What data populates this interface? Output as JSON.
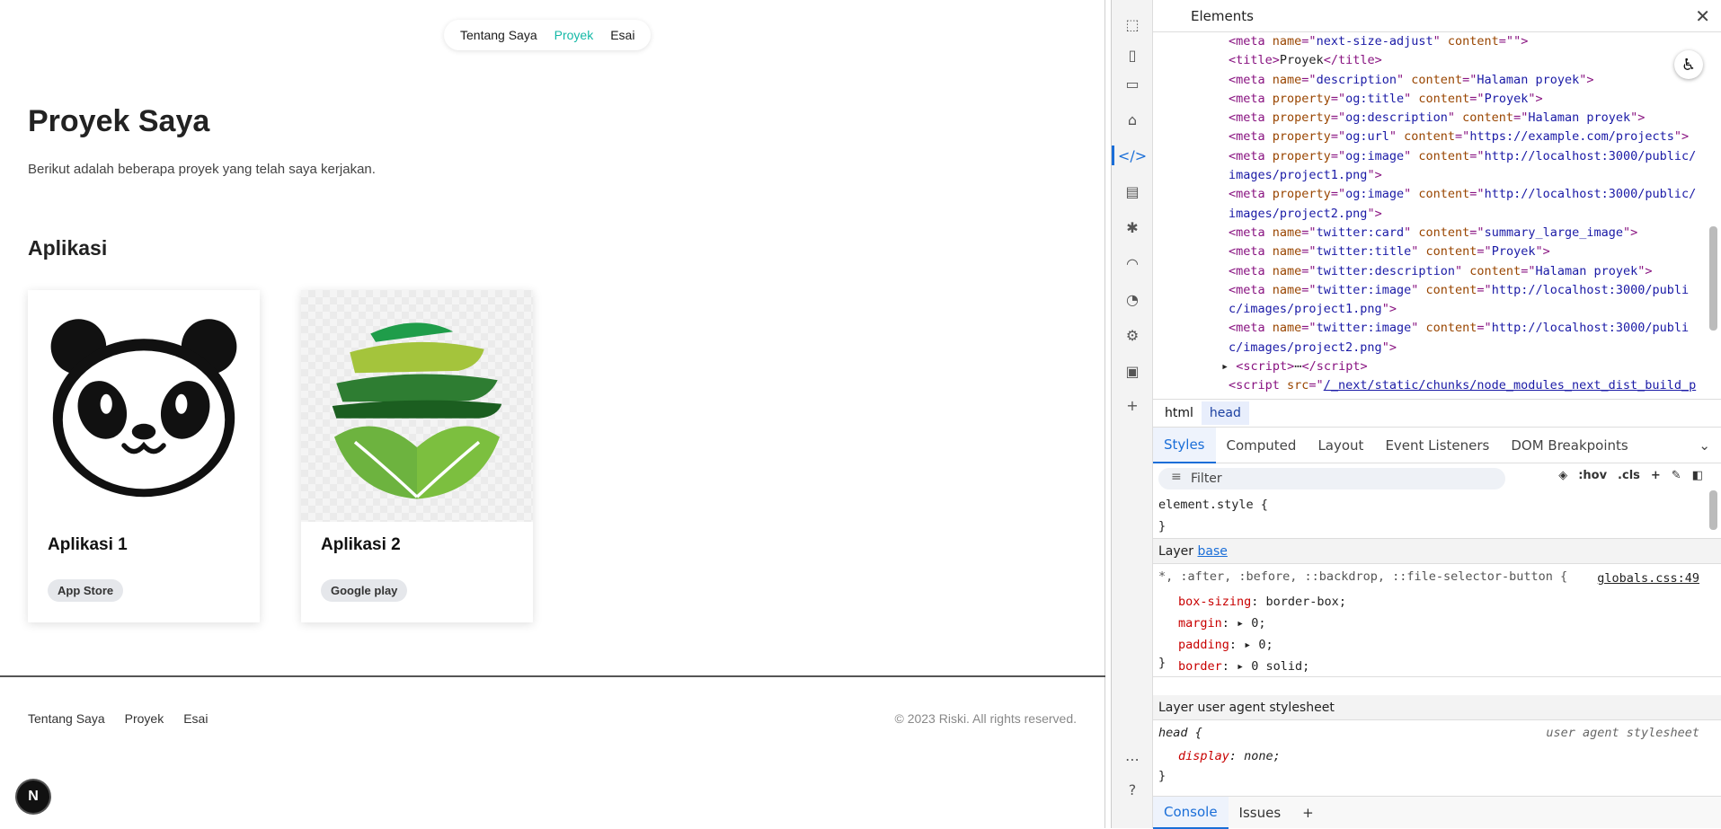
{
  "site": {
    "nav": [
      "Tentang Saya",
      "Proyek",
      "Esai"
    ],
    "nav_active": "Proyek",
    "title": "Proyek Saya",
    "intro": "Berikut adalah beberapa proyek yang telah saya kerjakan.",
    "section": "Aplikasi",
    "cards": [
      {
        "name": "Aplikasi 1",
        "tag": "App Store",
        "image": "panda-logo"
      },
      {
        "name": "Aplikasi 2",
        "tag": "Google play",
        "image": "leaf-logo"
      }
    ],
    "footer_links": [
      "Tentang Saya",
      "Proyek",
      "Esai"
    ],
    "copyright": "© 2023 Riski. All rights reserved.",
    "next_badge": "N"
  },
  "devtools": {
    "panel_title": "Elements",
    "close": "✕",
    "breadcrumbs": [
      "html",
      "head"
    ],
    "tabs": [
      "Styles",
      "Computed",
      "Layout",
      "Event Listeners",
      "DOM Breakpoints"
    ],
    "filter_placeholder": "Filter",
    "filter_tools": [
      ":hov",
      ".cls",
      "+"
    ],
    "code_lines": [
      {
        "tag": "meta",
        "attrs": [
          [
            "name",
            "next-size-adjust"
          ],
          [
            "content",
            ""
          ]
        ]
      },
      {
        "tag": "title",
        "text": "Proyek"
      },
      {
        "tag": "meta",
        "attrs": [
          [
            "name",
            "description"
          ],
          [
            "content",
            "Halaman proyek"
          ]
        ]
      },
      {
        "tag": "meta",
        "attrs": [
          [
            "property",
            "og:title"
          ],
          [
            "content",
            "Proyek"
          ]
        ]
      },
      {
        "tag": "meta",
        "attrs": [
          [
            "property",
            "og:description"
          ],
          [
            "content",
            "Halaman proyek"
          ]
        ]
      },
      {
        "tag": "meta",
        "attrs": [
          [
            "property",
            "og:url"
          ],
          [
            "content",
            "https://example.com/projects"
          ]
        ]
      },
      {
        "tag": "meta",
        "attrs": [
          [
            "property",
            "og:image"
          ],
          [
            "content",
            "http://localhost:3000/public/images/project1.png"
          ]
        ]
      },
      {
        "tag": "meta",
        "attrs": [
          [
            "property",
            "og:image"
          ],
          [
            "content",
            "http://localhost:3000/public/images/project2.png"
          ]
        ]
      },
      {
        "tag": "meta",
        "attrs": [
          [
            "name",
            "twitter:card"
          ],
          [
            "content",
            "summary_large_image"
          ]
        ]
      },
      {
        "tag": "meta",
        "attrs": [
          [
            "name",
            "twitter:title"
          ],
          [
            "content",
            "Proyek"
          ]
        ]
      },
      {
        "tag": "meta",
        "attrs": [
          [
            "name",
            "twitter:description"
          ],
          [
            "content",
            "Halaman proyek"
          ]
        ]
      },
      {
        "tag": "meta",
        "attrs": [
          [
            "name",
            "twitter:image"
          ],
          [
            "content",
            "http://localhost:3000/public/images/project1.png"
          ]
        ]
      },
      {
        "tag": "meta",
        "attrs": [
          [
            "name",
            "twitter:image"
          ],
          [
            "content",
            "http://localhost:3000/public/images/project2.png"
          ]
        ]
      },
      {
        "tag": "script",
        "collapsed": true
      },
      {
        "tag": "script",
        "src": "/_next/static/chunks/node_modules_next_dist_build_polyf"
      }
    ],
    "styles": {
      "element_style": "element.style {",
      "close_brace": "}",
      "layer_base_label": "Layer",
      "layer_base_link": "base",
      "universal_selector": "*, :after, :before, ::backdrop, ::file-selector-button {",
      "universal_source": "globals.css:49",
      "props": [
        {
          "name": "box-sizing",
          "value": "border-box;"
        },
        {
          "name": "margin",
          "value": "0;"
        },
        {
          "name": "padding",
          "value": "0;"
        },
        {
          "name": "border",
          "value": "0 solid;"
        }
      ],
      "layer_ua": "Layer user agent stylesheet",
      "head_selector": "head {",
      "ua_source": "user agent stylesheet",
      "head_prop": {
        "name": "display",
        "value": "none;"
      }
    },
    "console_tabs": [
      "Console",
      "Issues",
      "+"
    ]
  }
}
